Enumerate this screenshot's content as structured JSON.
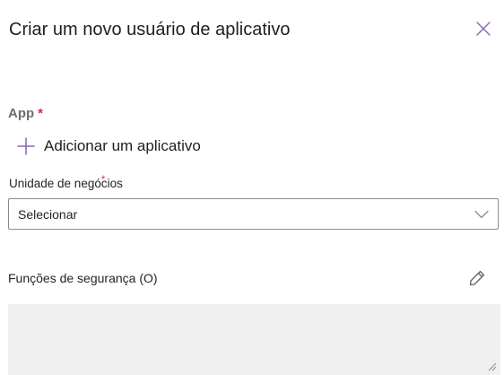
{
  "panel": {
    "title": "Criar um novo usuário de aplicativo",
    "close_icon": "close-icon"
  },
  "app_section": {
    "label": "App",
    "required_marker": "*",
    "add_label": "Adicionar um aplicativo",
    "add_icon": "plus-icon"
  },
  "business_unit": {
    "label": "Unidade de negócios",
    "required_marker": "*",
    "selected_value": "Selecionar",
    "chevron_icon": "chevron-down-icon"
  },
  "security_roles": {
    "label": "Funções de segurança (O)",
    "edit_icon": "pencil-icon"
  },
  "colors": {
    "accent": "#8764b8",
    "required": "#c4314b",
    "field_background": "#f0f0f0",
    "border": "#8a8a8a"
  }
}
